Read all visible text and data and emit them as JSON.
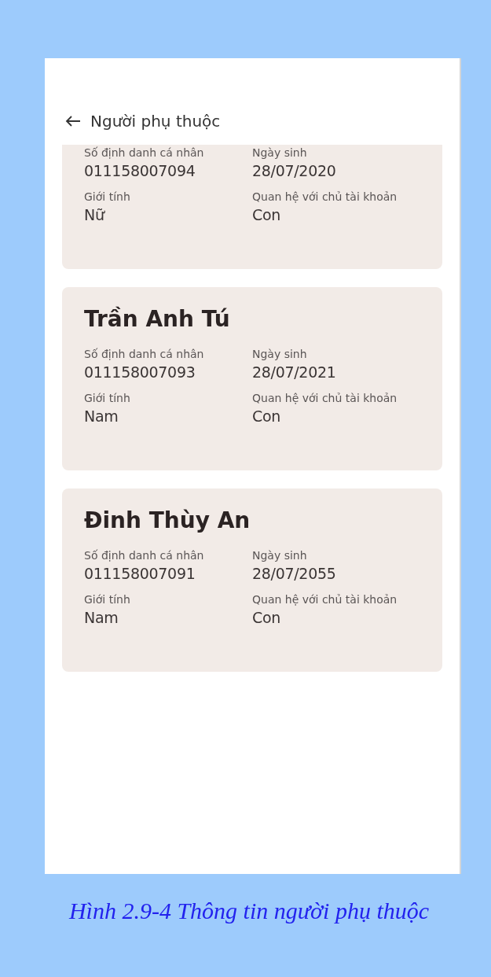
{
  "header": {
    "title": "Người phụ thuộc"
  },
  "dependents": [
    {
      "fields": [
        {
          "label": "Số định danh cá nhân",
          "value": "011158007094"
        },
        {
          "label": "Ngày sinh",
          "value": "28/07/2020"
        },
        {
          "label": "Giới tính",
          "value": "Nữ"
        },
        {
          "label": "Quan hệ với chủ tài khoản",
          "value": "Con"
        }
      ]
    },
    {
      "name": "Trần Anh Tú",
      "fields": [
        {
          "label": "Số định danh cá nhân",
          "value": "011158007093"
        },
        {
          "label": "Ngày sinh",
          "value": "28/07/2021"
        },
        {
          "label": "Giới tính",
          "value": "Nam"
        },
        {
          "label": "Quan hệ với chủ tài khoản",
          "value": "Con"
        }
      ]
    },
    {
      "name": "Đinh Thùy An",
      "fields": [
        {
          "label": "Số định danh cá nhân",
          "value": "011158007091"
        },
        {
          "label": "Ngày sinh",
          "value": "28/07/2055"
        },
        {
          "label": "Giới tính",
          "value": "Nam"
        },
        {
          "label": "Quan hệ với chủ tài khoản",
          "value": "Con"
        }
      ]
    }
  ],
  "caption": "Hình 2.9-4 Thông tin người phụ thuộc"
}
